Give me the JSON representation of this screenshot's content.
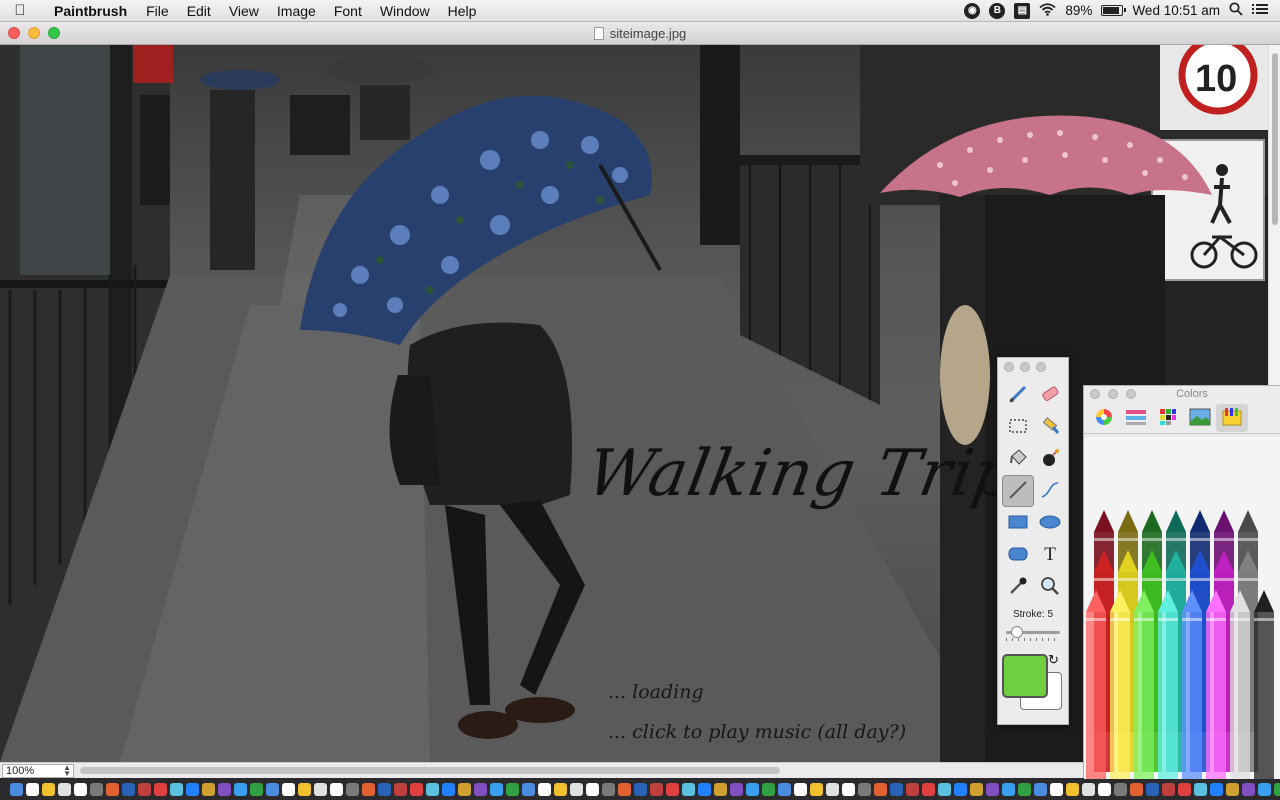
{
  "menubar": {
    "apple_icon": "apple-icon",
    "app_name": "Paintbrush",
    "menus": [
      "File",
      "Edit",
      "View",
      "Image",
      "Font",
      "Window",
      "Help"
    ],
    "battery_percent": "89%",
    "battery_level": 0.89,
    "clock": "Wed 10:51 am",
    "status_icons": [
      "gauge-icon",
      "b-icon",
      "display-icon",
      "wifi-icon",
      "battery-icon",
      "spotlight-icon",
      "list-icon"
    ]
  },
  "window": {
    "title": "siteimage.jpg"
  },
  "canvas": {
    "title_text": "Walking Trip",
    "loading_text": "... loading",
    "music_text": "... click to play music (all day?)"
  },
  "statusbar": {
    "zoom": "100%"
  },
  "tools_palette": {
    "stroke_label": "Stroke: 5",
    "stroke_value": 5,
    "foreground_color": "#6fcf3f",
    "background_color": "#ffffff",
    "tools": [
      "brush",
      "eraser",
      "selection",
      "fill-bucket",
      "spray",
      "bomb",
      "line",
      "curve",
      "rectangle",
      "ellipse",
      "rounded-rectangle",
      "text",
      "eyedropper",
      "zoom"
    ],
    "selected_tool": "line"
  },
  "colors_panel": {
    "title": "Colors",
    "tabs": [
      "color-wheel",
      "sliders",
      "palettes",
      "image",
      "crayons"
    ],
    "selected_tab": "crayons",
    "crayon_colors": [
      "#7a1020",
      "#7a6a10",
      "#1c6a20",
      "#106a5a",
      "#102a70",
      "#6a1070",
      "#4a4a4a",
      "#cc2222",
      "#e0d020",
      "#40c020",
      "#20b0a0",
      "#2050d0",
      "#c020c0",
      "#808080",
      "#ff6060",
      "#fff060",
      "#80f060",
      "#60f0e0",
      "#6090ff",
      "#ff70ff",
      "#e0e0e0",
      "#202020"
    ]
  }
}
